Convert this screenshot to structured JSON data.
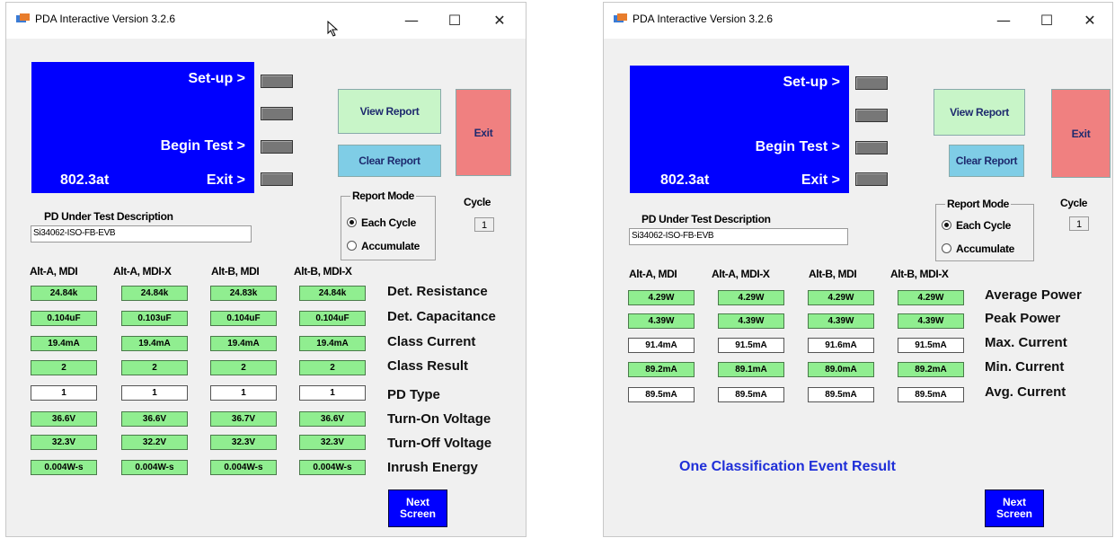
{
  "left": {
    "title": "PDA Interactive Version 3.2.6",
    "window_buttons": {
      "minimize": "—",
      "maximize": "☐",
      "close": "✕"
    },
    "screen": {
      "setup": "Set-up >",
      "begin": "Begin Test >",
      "exit": "Exit >",
      "standard": "802.3at"
    },
    "view_report": "View Report",
    "clear_report": "Clear Report",
    "exit": "Exit",
    "report_mode": {
      "legend": "Report Mode",
      "each": "Each Cycle",
      "accumulate": "Accumulate",
      "selected": "Each Cycle"
    },
    "cycle": {
      "label": "Cycle",
      "value": "1"
    },
    "desc_label": "PD Under Test Description",
    "desc_value": "Si34062-ISO-FB-EVB",
    "columns": [
      "Alt-A, MDI",
      "Alt-A, MDI-X",
      "Alt-B, MDI",
      "Alt-B, MDI-X"
    ],
    "rows": [
      {
        "label": "Det. Resistance",
        "values": [
          "24.84k",
          "24.84k",
          "24.83k",
          "24.84k"
        ],
        "color": "green"
      },
      {
        "label": "Det. Capacitance",
        "values": [
          "0.104uF",
          "0.103uF",
          "0.104uF",
          "0.104uF"
        ],
        "color": "green"
      },
      {
        "label": "Class Current",
        "values": [
          "19.4mA",
          "19.4mA",
          "19.4mA",
          "19.4mA"
        ],
        "color": "green"
      },
      {
        "label": "Class Result",
        "values": [
          "2",
          "2",
          "2",
          "2"
        ],
        "color": "green"
      },
      {
        "label": "PD Type",
        "values": [
          "1",
          "1",
          "1",
          "1"
        ],
        "color": "white"
      },
      {
        "label": "Turn-On Voltage",
        "values": [
          "36.6V",
          "36.6V",
          "36.7V",
          "36.6V"
        ],
        "color": "green"
      },
      {
        "label": "Turn-Off Voltage",
        "values": [
          "32.3V",
          "32.2V",
          "32.3V",
          "32.3V"
        ],
        "color": "green"
      },
      {
        "label": "Inrush Energy",
        "values": [
          "0.004W-s",
          "0.004W-s",
          "0.004W-s",
          "0.004W-s"
        ],
        "color": "green"
      }
    ],
    "next": {
      "line1": "Next",
      "line2": "Screen"
    }
  },
  "right": {
    "title": "PDA Interactive Version 3.2.6",
    "window_buttons": {
      "minimize": "—",
      "maximize": "☐",
      "close": "✕"
    },
    "screen": {
      "setup": "Set-up >",
      "begin": "Begin Test >",
      "exit": "Exit >",
      "standard": "802.3at"
    },
    "view_report": "View Report",
    "clear_report": "Clear Report",
    "exit": "Exit",
    "report_mode": {
      "legend": "Report Mode",
      "each": "Each Cycle",
      "accumulate": "Accumulate",
      "selected": "Each Cycle"
    },
    "cycle": {
      "label": "Cycle",
      "value": "1"
    },
    "desc_label": "PD Under Test Description",
    "desc_value": "Si34062-ISO-FB-EVB",
    "columns": [
      "Alt-A, MDI",
      "Alt-A, MDI-X",
      "Alt-B, MDI",
      "Alt-B, MDI-X"
    ],
    "rows": [
      {
        "label": "Average Power",
        "values": [
          "4.29W",
          "4.29W",
          "4.29W",
          "4.29W"
        ],
        "color": "green"
      },
      {
        "label": "Peak Power",
        "values": [
          "4.39W",
          "4.39W",
          "4.39W",
          "4.39W"
        ],
        "color": "green"
      },
      {
        "label": "Max. Current",
        "values": [
          "91.4mA",
          "91.5mA",
          "91.6mA",
          "91.5mA"
        ],
        "color": "white"
      },
      {
        "label": "Min. Current",
        "values": [
          "89.2mA",
          "89.1mA",
          "89.0mA",
          "89.2mA"
        ],
        "color": "green"
      },
      {
        "label": "Avg. Current",
        "values": [
          "89.5mA",
          "89.5mA",
          "89.5mA",
          "89.5mA"
        ],
        "color": "white"
      }
    ],
    "event_text": "One  Classification  Event Result",
    "next": {
      "line1": "Next",
      "line2": "Screen"
    }
  },
  "colors": {
    "screen_blue": "#0000ff",
    "view_report_bg": "#c8f5c8",
    "clear_report_bg": "#7fcde6",
    "exit_bg": "#f08080",
    "cell_green": "#90ee90",
    "next_blue": "#0000ff",
    "event_text": "#1f2fd8"
  }
}
